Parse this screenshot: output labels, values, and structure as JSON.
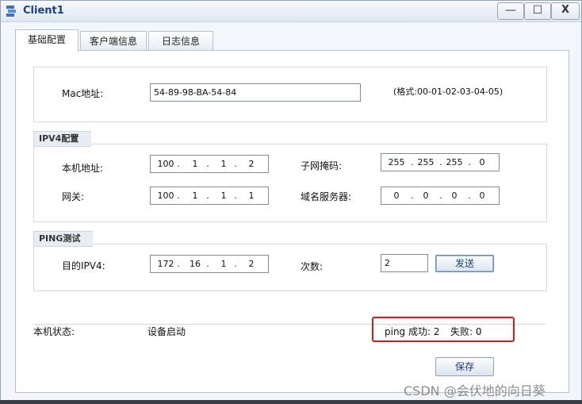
{
  "window": {
    "title": "Client1"
  },
  "window_controls": {
    "minimize": "—",
    "maximize": "☐",
    "close": "X"
  },
  "tabs": [
    {
      "label": "基础配置",
      "active": true
    },
    {
      "label": "客户端信息",
      "active": false
    },
    {
      "label": "日志信息",
      "active": false
    }
  ],
  "mac": {
    "label": "Mac地址:",
    "value": "54-89-98-BA-54-84",
    "hint": "(格式:00-01-02-03-04-05)"
  },
  "ipv4": {
    "section_label": "IPV4配置",
    "local_label": "本机地址:",
    "local": [
      "100",
      "1",
      "1",
      "2"
    ],
    "mask_label": "子网掩码:",
    "mask": [
      "255",
      "255",
      "255",
      "0"
    ],
    "gateway_label": "网关:",
    "gateway": [
      "100",
      "1",
      "1",
      "1"
    ],
    "dns_label": "域名服务器:",
    "dns": [
      "0",
      "0",
      "0",
      "0"
    ]
  },
  "ping": {
    "section_label": "PING测试",
    "dest_label": "目的IPV4:",
    "dest": [
      "172",
      "16",
      "1",
      "2"
    ],
    "count_label": "次数:",
    "count": "2",
    "send_label": "发送"
  },
  "status": {
    "label": "本机状态:",
    "value": "设备启动",
    "ping_success": "ping 成功: 2",
    "ping_fail": "失败: 0"
  },
  "save_label": "保存",
  "watermark": "CSDN @会伏地的向日葵",
  "colors": {
    "accent_red": "#e0161b",
    "title_blue": "#1b3f8b"
  }
}
